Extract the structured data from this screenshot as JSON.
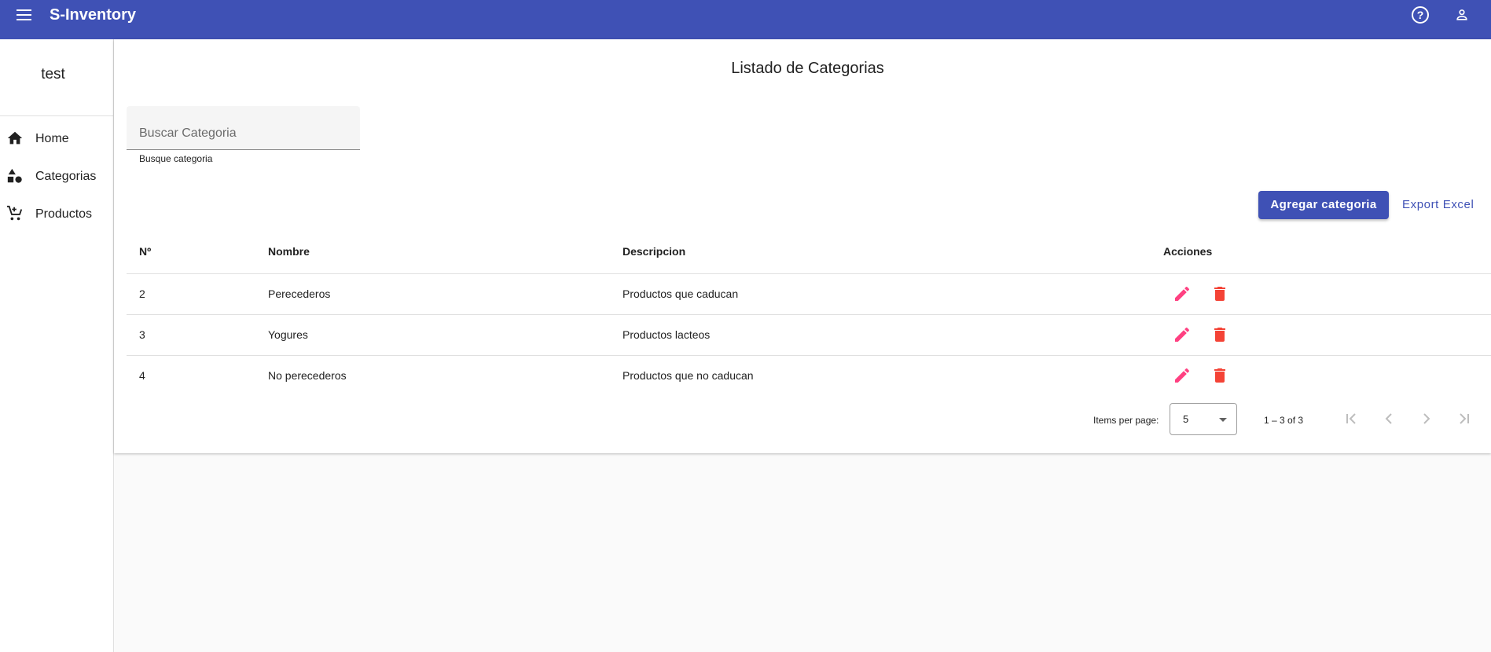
{
  "app": {
    "title": "S-Inventory"
  },
  "sidebar": {
    "user": "test",
    "items": [
      {
        "label": "Home",
        "icon": "home-icon"
      },
      {
        "label": "Categorias",
        "icon": "category-icon"
      },
      {
        "label": "Productos",
        "icon": "cart-icon"
      }
    ]
  },
  "main": {
    "title": "Listado de Categorias",
    "search": {
      "placeholder": "Buscar Categoria",
      "value": "",
      "hint": "Busque categoria"
    },
    "add_label": "Agregar categoria",
    "export_label": "Export Excel",
    "table": {
      "headers": [
        "Nº",
        "Nombre",
        "Descripcion",
        "Acciones"
      ],
      "rows": [
        {
          "id": "2",
          "nombre": "Perecederos",
          "descripcion": "Productos que caducan"
        },
        {
          "id": "3",
          "nombre": "Yogures",
          "descripcion": "Productos lacteos"
        },
        {
          "id": "4",
          "nombre": "No perecederos",
          "descripcion": "Productos que no caducan"
        }
      ]
    },
    "paginator": {
      "items_per_page_label": "Items per page:",
      "page_size": "5",
      "range": "1 – 3 of 3"
    }
  },
  "colors": {
    "primary": "#3f51b5",
    "edit": "#ff4081",
    "delete": "#f44336"
  }
}
